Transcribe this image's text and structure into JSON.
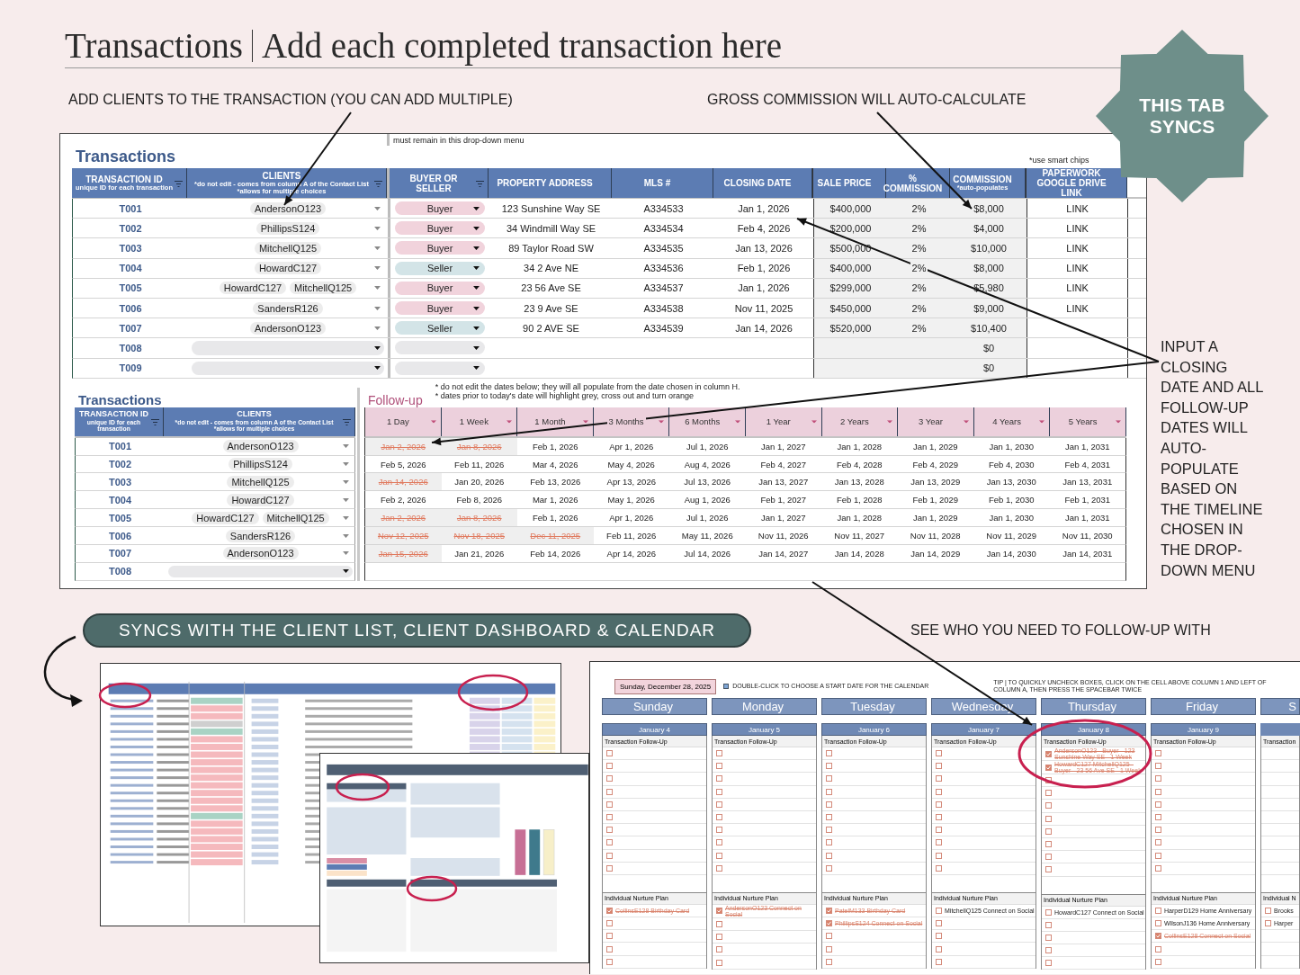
{
  "title": {
    "main": "Transactions",
    "subtitle": "Add each completed transaction here"
  },
  "badge": [
    "THIS TAB",
    "SYNCS"
  ],
  "callouts": [
    "ADD CLIENTS TO THE TRANSACTION (YOU CAN ADD MULTIPLE)",
    "GROSS COMMISSION WILL AUTO-CALCULATE"
  ],
  "transactions": {
    "title": "Transactions",
    "dropdown_note": "must remain in this drop-down menu",
    "chips_note": "*use smart chips",
    "columns": [
      {
        "label": "TRANSACTION ID",
        "notes": [
          "unique ID for each transaction"
        ],
        "filter": true
      },
      {
        "label": "CLIENTS",
        "notes": [
          "*do not edit - comes from column A of the Contact List",
          "*allows for multiple choices"
        ],
        "filter": true
      },
      {
        "label": "BUYER OR SELLER",
        "filter": true
      },
      {
        "label": "PROPERTY ADDRESS",
        "filter": false
      },
      {
        "label": "MLS #",
        "filter": false
      },
      {
        "label": "CLOSING DATE",
        "filter": false
      },
      {
        "label": "SALE PRICE",
        "filter": false
      },
      {
        "label": "% COMMISSION",
        "filter": false
      },
      {
        "label": "COMMISSION",
        "notes": [
          "*auto-populates"
        ],
        "filter": false
      },
      {
        "label": "PAPERWORK GOOGLE DRIVE LINK",
        "filter": false
      }
    ],
    "rows": [
      {
        "id": "T001",
        "clients": [
          "AndersonO123"
        ],
        "role": {
          "label": "Buyer",
          "kind": "buyer"
        },
        "address": "123 Sunshine Way SE",
        "mls": "A334533",
        "closing": "Jan 1, 2026",
        "price": "$400,000",
        "pct": "2%",
        "commission": "$8,000",
        "link": "LINK"
      },
      {
        "id": "T002",
        "clients": [
          "PhillipsS124"
        ],
        "role": {
          "label": "Buyer",
          "kind": "buyer"
        },
        "address": "34 Windmill Way SE",
        "mls": "A334534",
        "closing": "Feb 4, 2026",
        "price": "$200,000",
        "pct": "2%",
        "commission": "$4,000",
        "link": "LINK"
      },
      {
        "id": "T003",
        "clients": [
          "MitchellQ125"
        ],
        "role": {
          "label": "Buyer",
          "kind": "buyer"
        },
        "address": "89 Taylor Road SW",
        "mls": "A334535",
        "closing": "Jan 13, 2026",
        "price": "$500,000",
        "pct": "2%",
        "commission": "$10,000",
        "link": "LINK"
      },
      {
        "id": "T004",
        "clients": [
          "HowardC127"
        ],
        "role": {
          "label": "Seller",
          "kind": "seller"
        },
        "address": "34 2 Ave NE",
        "mls": "A334536",
        "closing": "Feb 1, 2026",
        "price": "$400,000",
        "pct": "2%",
        "commission": "$8,000",
        "link": "LINK"
      },
      {
        "id": "T005",
        "clients": [
          "HowardC127",
          "MitchellQ125"
        ],
        "role": {
          "label": "Buyer",
          "kind": "buyer"
        },
        "address": "23 56 Ave SE",
        "mls": "A334537",
        "closing": "Jan 1, 2026",
        "price": "$299,000",
        "pct": "2%",
        "commission": "$5,980",
        "link": "LINK"
      },
      {
        "id": "T006",
        "clients": [
          "SandersR126"
        ],
        "role": {
          "label": "Buyer",
          "kind": "buyer"
        },
        "address": "23 9 Ave SE",
        "mls": "A334538",
        "closing": "Nov 11, 2025",
        "price": "$450,000",
        "pct": "2%",
        "commission": "$9,000",
        "link": "LINK"
      },
      {
        "id": "T007",
        "clients": [
          "AndersonO123"
        ],
        "role": {
          "label": "Seller",
          "kind": "seller"
        },
        "address": "90 2 AVE SE",
        "mls": "A334539",
        "closing": "Jan 14, 2026",
        "price": "$520,000",
        "pct": "2%",
        "commission": "$10,400"
      },
      {
        "id": "T008",
        "role": {
          "kind": "empty"
        },
        "commission": "$0"
      },
      {
        "id": "T009",
        "role": {
          "kind": "empty"
        },
        "commission": "$0"
      }
    ]
  },
  "followup": {
    "title": "Transactions",
    "subtitle": "Follow-up",
    "notes": [
      "* do not edit the dates below; they will all populate from the date chosen in column H.",
      "* dates prior to today's date will highlight grey, cross out and turn orange"
    ],
    "left_columns": [
      {
        "label": "TRANSACTION ID",
        "notes": [
          "unique ID for each transaction"
        ],
        "filter": true
      },
      {
        "label": "CLIENTS",
        "notes": [
          "*do not edit - comes from column A of the Contact List",
          "*allows for multiple choices"
        ],
        "filter": true
      }
    ],
    "periods": [
      "1 Day",
      "1 Week",
      "1 Month",
      "3 Months",
      "6 Months",
      "1 Year",
      "2 Years",
      "3 Year",
      "4 Years",
      "5 Years"
    ],
    "rows": [
      {
        "id": "T001",
        "clients": [
          "AndersonO123"
        ],
        "dates": [
          {
            "text": "Jan 2, 2026",
            "past": true
          },
          {
            "text": "Jan 8, 2026",
            "past": true
          },
          {
            "text": "Feb 1, 2026",
            "past": false
          },
          {
            "text": "Apr 1, 2026",
            "past": false
          },
          {
            "text": "Jul 1, 2026",
            "past": false
          },
          {
            "text": "Jan 1, 2027",
            "past": false
          },
          {
            "text": "Jan 1, 2028",
            "past": false
          },
          {
            "text": "Jan 1, 2029",
            "past": false
          },
          {
            "text": "Jan 1, 2030",
            "past": false
          },
          {
            "text": "Jan 1, 2031",
            "past": false
          }
        ]
      },
      {
        "id": "T002",
        "clients": [
          "PhillipsS124"
        ],
        "dates": [
          {
            "text": "Feb 5, 2026",
            "past": false
          },
          {
            "text": "Feb 11, 2026",
            "past": false
          },
          {
            "text": "Mar 4, 2026",
            "past": false
          },
          {
            "text": "May 4, 2026",
            "past": false
          },
          {
            "text": "Aug 4, 2026",
            "past": false
          },
          {
            "text": "Feb 4, 2027",
            "past": false
          },
          {
            "text": "Feb 4, 2028",
            "past": false
          },
          {
            "text": "Feb 4, 2029",
            "past": false
          },
          {
            "text": "Feb 4, 2030",
            "past": false
          },
          {
            "text": "Feb 4, 2031",
            "past": false
          }
        ]
      },
      {
        "id": "T003",
        "clients": [
          "MitchellQ125"
        ],
        "dates": [
          {
            "text": "Jan 14, 2026",
            "past": true
          },
          {
            "text": "Jan 20, 2026",
            "past": false
          },
          {
            "text": "Feb 13, 2026",
            "past": false
          },
          {
            "text": "Apr 13, 2026",
            "past": false
          },
          {
            "text": "Jul 13, 2026",
            "past": false
          },
          {
            "text": "Jan 13, 2027",
            "past": false
          },
          {
            "text": "Jan 13, 2028",
            "past": false
          },
          {
            "text": "Jan 13, 2029",
            "past": false
          },
          {
            "text": "Jan 13, 2030",
            "past": false
          },
          {
            "text": "Jan 13, 2031",
            "past": false
          }
        ]
      },
      {
        "id": "T004",
        "clients": [
          "HowardC127"
        ],
        "dates": [
          {
            "text": "Feb 2, 2026",
            "past": false
          },
          {
            "text": "Feb 8, 2026",
            "past": false
          },
          {
            "text": "Mar 1, 2026",
            "past": false
          },
          {
            "text": "May 1, 2026",
            "past": false
          },
          {
            "text": "Aug 1, 2026",
            "past": false
          },
          {
            "text": "Feb 1, 2027",
            "past": false
          },
          {
            "text": "Feb 1, 2028",
            "past": false
          },
          {
            "text": "Feb 1, 2029",
            "past": false
          },
          {
            "text": "Feb 1, 2030",
            "past": false
          },
          {
            "text": "Feb 1, 2031",
            "past": false
          }
        ]
      },
      {
        "id": "T005",
        "clients": [
          "HowardC127",
          "MitchellQ125"
        ],
        "dates": [
          {
            "text": "Jan 2, 2026",
            "past": true
          },
          {
            "text": "Jan 8, 2026",
            "past": true
          },
          {
            "text": "Feb 1, 2026",
            "past": false
          },
          {
            "text": "Apr 1, 2026",
            "past": false
          },
          {
            "text": "Jul 1, 2026",
            "past": false
          },
          {
            "text": "Jan 1, 2027",
            "past": false
          },
          {
            "text": "Jan 1, 2028",
            "past": false
          },
          {
            "text": "Jan 1, 2029",
            "past": false
          },
          {
            "text": "Jan 1, 2030",
            "past": false
          },
          {
            "text": "Jan 1, 2031",
            "past": false
          }
        ]
      },
      {
        "id": "T006",
        "clients": [
          "SandersR126"
        ],
        "dates": [
          {
            "text": "Nov 12, 2025",
            "past": true
          },
          {
            "text": "Nov 18, 2025",
            "past": true
          },
          {
            "text": "Dec 11, 2025",
            "past": true
          },
          {
            "text": "Feb 11, 2026",
            "past": false
          },
          {
            "text": "May 11, 2026",
            "past": false
          },
          {
            "text": "Nov 11, 2026",
            "past": false
          },
          {
            "text": "Nov 11, 2027",
            "past": false
          },
          {
            "text": "Nov 11, 2028",
            "past": false
          },
          {
            "text": "Nov 11, 2029",
            "past": false
          },
          {
            "text": "Nov 11, 2030",
            "past": false
          }
        ]
      },
      {
        "id": "T007",
        "clients": [
          "AndersonO123"
        ],
        "dates": [
          {
            "text": "Jan 15, 2026",
            "past": true
          },
          {
            "text": "Jan 21, 2026",
            "past": false
          },
          {
            "text": "Feb 14, 2026",
            "past": false
          },
          {
            "text": "Apr 14, 2026",
            "past": false
          },
          {
            "text": "Jul 14, 2026",
            "past": false
          },
          {
            "text": "Jan 14, 2027",
            "past": false
          },
          {
            "text": "Jan 14, 2028",
            "past": false
          },
          {
            "text": "Jan 14, 2029",
            "past": false
          },
          {
            "text": "Jan 14, 2030",
            "past": false
          },
          {
            "text": "Jan 14, 2031",
            "past": false
          }
        ]
      },
      {
        "id": "T008"
      }
    ]
  },
  "side_note": "INPUT A CLOSING DATE AND ALL FOLLOW-UP DATES WILL AUTO-POPULATE BASED ON THE TIMELINE CHOSEN IN THE DROP-DOWN MENU",
  "banner": "SYNCS WITH THE CLIENT LIST, CLIENT DASHBOARD & CALENDAR",
  "banner_note": "SEE WHO YOU NEED TO FOLLOW-UP WITH",
  "calendar": {
    "start_date": "Sunday, December 28, 2025",
    "hint": "DOUBLE-CLICK TO CHOOSE A START DATE FOR THE CALENDAR",
    "tip": "TIP | TO QUICKLY UNCHECK BOXES, CLICK ON THE CELL ABOVE COLUMN 1 AND LEFT OF COLUMN A, THEN PRESS THE SPACEBAR TWICE",
    "columns": [
      {
        "kind": "day",
        "day": "Sunday",
        "date": "January 4",
        "followup_label": "Transaction Follow-Up",
        "nurture_label": "Individual Nurture Plan",
        "nurture": [
          {
            "text": "CollinsE128 Birthday Card",
            "checked": true
          }
        ]
      },
      {
        "kind": "day",
        "day": "Monday",
        "date": "January 5",
        "followup_label": "Transaction Follow-Up",
        "nurture_label": "Individual Nurture Plan",
        "nurture": [
          {
            "text": "AndersonO123 Connect on Social",
            "checked": true
          }
        ]
      },
      {
        "kind": "day",
        "day": "Tuesday",
        "date": "January 6",
        "followup_label": "Transaction Follow-Up",
        "nurture_label": "Individual Nurture Plan",
        "nurture": [
          {
            "text": "PatelM133 Birthday Card",
            "checked": true
          },
          {
            "text": "PhillipsS124 Connect on Social",
            "checked": true
          }
        ]
      },
      {
        "kind": "day",
        "day": "Wednesday",
        "date": "January 7",
        "followup_label": "Transaction Follow-Up",
        "nurture_label": "Individual Nurture Plan",
        "nurture": [
          {
            "text": "MitchellQ125 Connect on Social",
            "checked": false
          }
        ]
      },
      {
        "kind": "day",
        "day": "Thursday",
        "date": "January 8",
        "followup_label": "Transaction Follow-Up",
        "followups": [
          {
            "text": "AndersonO123 - Buyer - 123 Sunshine Way SE - 1 Week",
            "checked": true
          },
          {
            "text": "HowardC127 MitchellQ125 - Buyer - 23 56 Ave SE - 1 Week",
            "checked": true
          }
        ],
        "nurture_label": "Individual Nurture Plan",
        "nurture": [
          {
            "text": "HowardC127 Connect on Social",
            "checked": false
          }
        ]
      },
      {
        "kind": "day",
        "day": "Friday",
        "date": "January 9",
        "followup_label": "Transaction Follow-Up",
        "nurture_label": "Individual Nurture Plan",
        "nurture": [
          {
            "text": "HarperD129 Home Anniversary",
            "checked": false
          },
          {
            "text": "WilsonJ136 Home Anniversary",
            "checked": false
          },
          {
            "text": "CollinsE128 Connect on Social",
            "checked": true
          }
        ]
      },
      {
        "kind": "cut",
        "day": "S",
        "followup_label": "Transaction",
        "nurture_label": "Individual N",
        "nurture": [
          {
            "text": "Brooks",
            "checked": false
          },
          {
            "text": "Harper",
            "checked": false
          }
        ]
      }
    ]
  }
}
